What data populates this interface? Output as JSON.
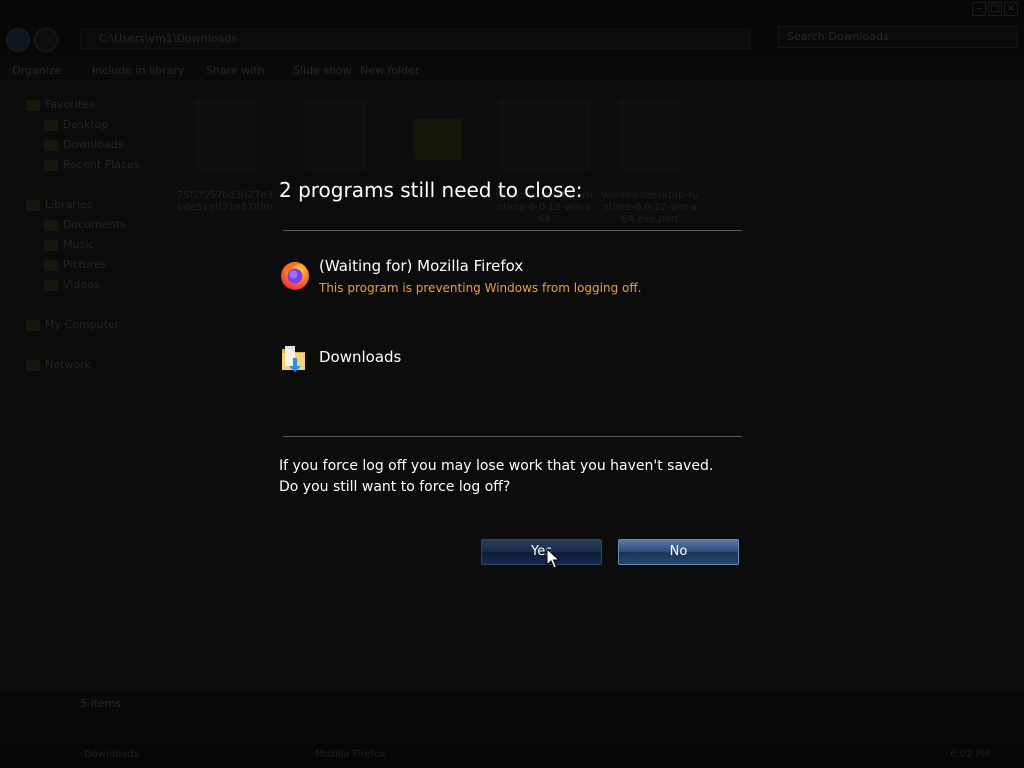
{
  "explorer": {
    "address": "C:\\Users\\vm1\\Downloads",
    "search_placeholder": "Search Downloads",
    "toolbar": [
      "Organize",
      "Include in library",
      "Share with",
      "Slide show",
      "New folder"
    ],
    "nav": {
      "favorites": "Favorites",
      "desktop": "Desktop",
      "downloads": "Downloads",
      "recent": "Recent Places",
      "libraries": "Libraries",
      "documents": "Documents",
      "music": "Music",
      "pictures": "Pictures",
      "videos": "Videos",
      "computer": "My Computer",
      "network": "Network"
    },
    "files": [
      "75f2f957bd3027e3bde51eff31e5789b",
      "",
      "",
      "windowsdesktop-runtime-6.0.12-win-x64",
      "windowsdesktop-runtime-6.0.12-win-x64.exe.part"
    ],
    "status": "5 items"
  },
  "taskbar": {
    "items": [
      "Downloads",
      "Mozilla Firefox"
    ],
    "clock": "6:02 PM"
  },
  "dialog": {
    "title": "2 programs still need to close:",
    "programs": [
      {
        "name": "(Waiting for) Mozilla Firefox",
        "note": "This program is preventing Windows from logging off.",
        "icon": "firefox-icon"
      },
      {
        "name": "Downloads",
        "icon": "folder-download-icon"
      }
    ],
    "message_line1": "If you force log off you may lose work that you haven't saved.",
    "message_line2": "Do you still want to force log off?",
    "yes_label": "Yes",
    "no_label": "No"
  },
  "colors": {
    "note": "#e0a447",
    "button": "#2f4d78",
    "text": "#ffffff"
  }
}
